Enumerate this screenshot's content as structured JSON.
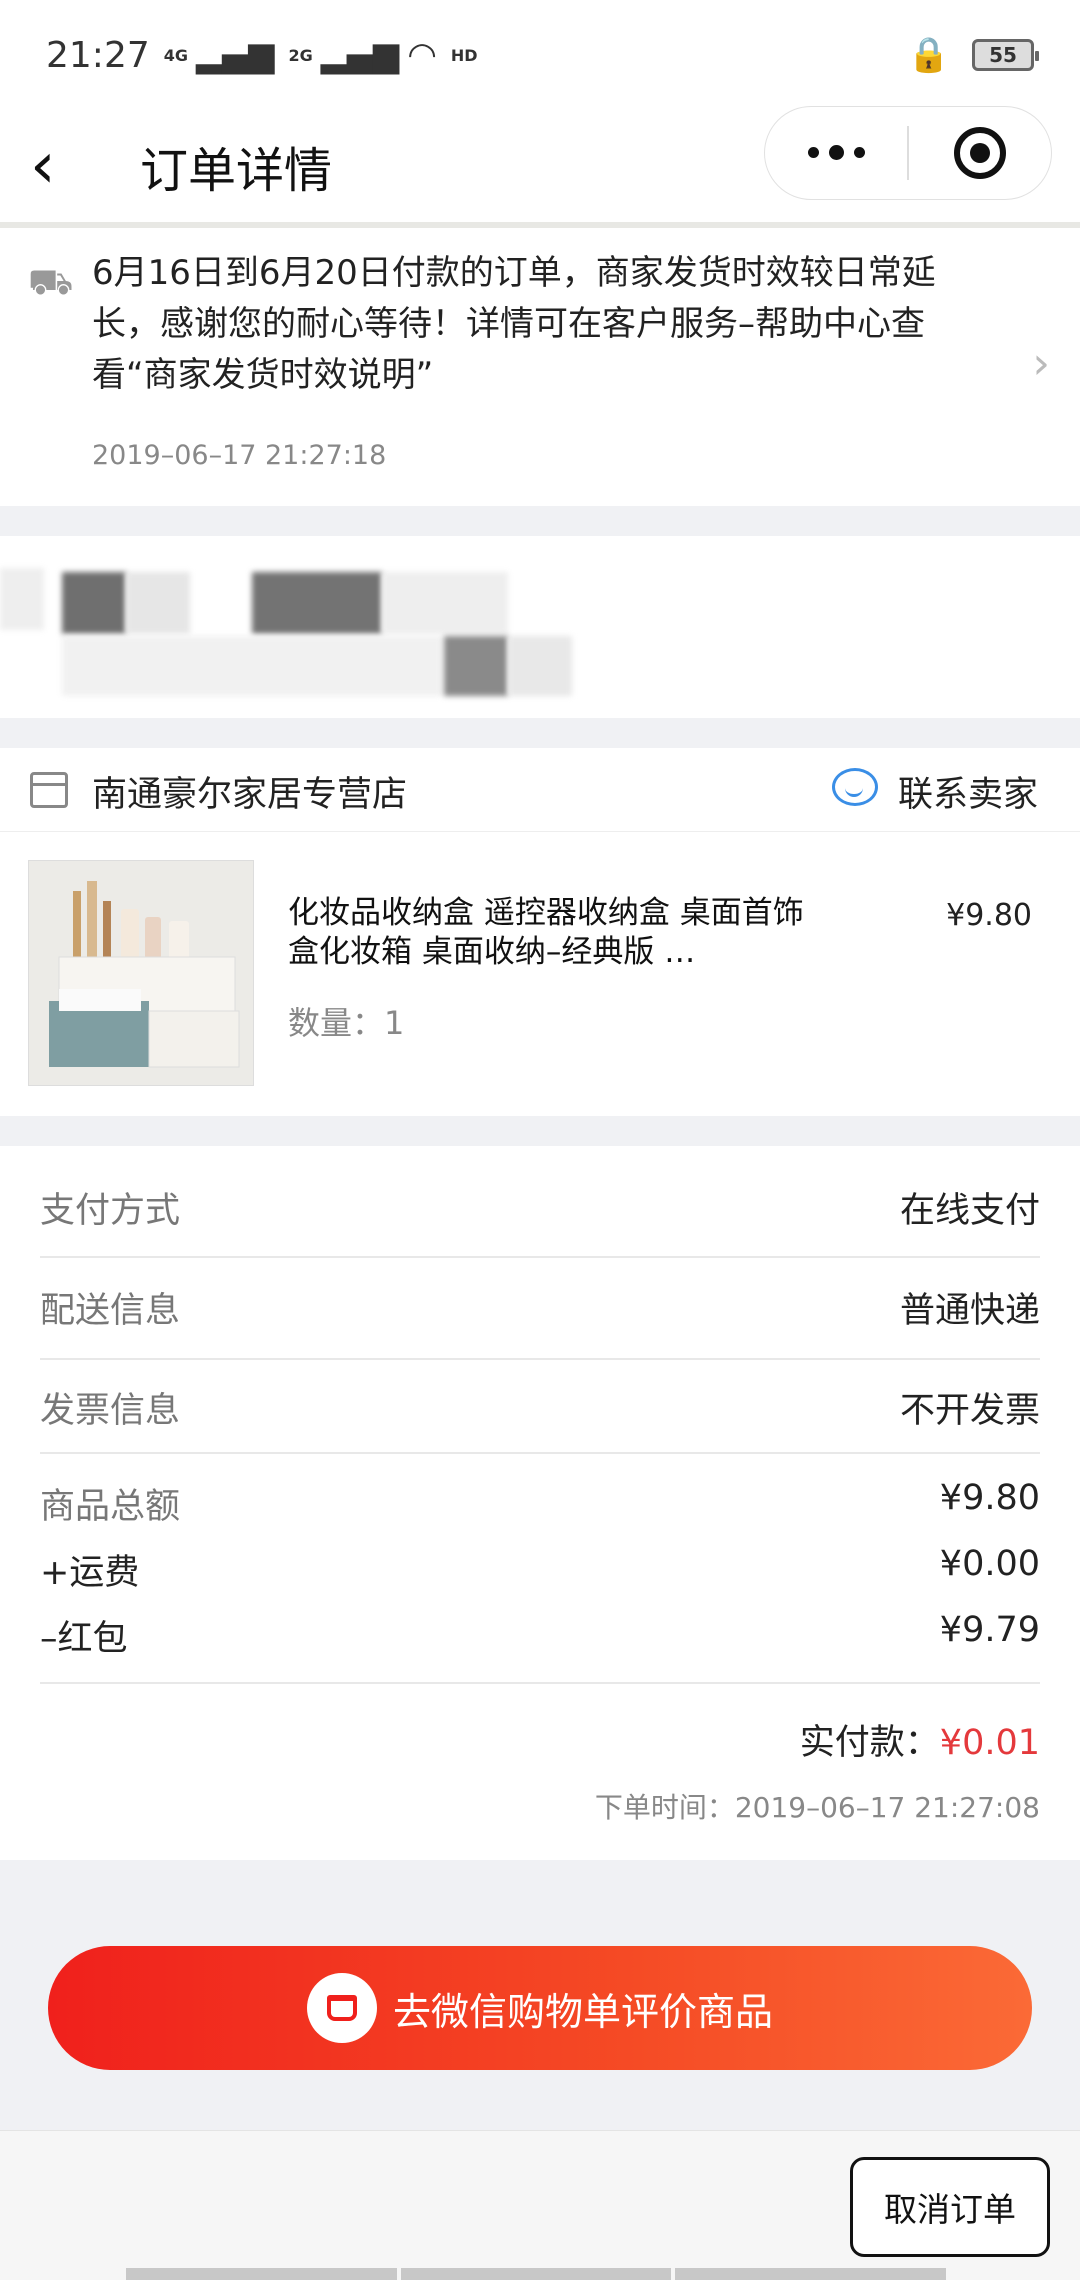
{
  "status_bar": {
    "time": "21:27",
    "signal1": "4G",
    "signal2": "2G",
    "network": "HD",
    "battery": "55"
  },
  "nav": {
    "title": "订单详情"
  },
  "notice": {
    "text": "6月16日到6月20日付款的订单，商家发货时效较日常延长，感谢您的耐心等待！详情可在客户服务–帮助中心查看“商家发货时效说明”",
    "time": "2019–06–17 21:27:18"
  },
  "shop": {
    "name": "南通豪尔家居专营店",
    "contact": "联系卖家"
  },
  "product": {
    "name": "化妆品收纳盒 遥控器收纳盒 桌面首饰盒化妆箱 桌面收纳–经典版 …",
    "price": "¥9.80",
    "quantity": "数量：1"
  },
  "info": {
    "payment": {
      "label": "支付方式",
      "value": "在线支付"
    },
    "delivery": {
      "label": "配送信息",
      "value": "普通快递"
    },
    "invoice": {
      "label": "发票信息",
      "value": "不开发票"
    },
    "subtotal": {
      "label": "商品总额",
      "value": "¥9.80"
    },
    "shipping": {
      "label": "+运费",
      "value": "¥0.00"
    },
    "redpacket": {
      "label": "–红包",
      "value": "¥9.79"
    },
    "paid_label": "实付款：",
    "paid_value": "¥0.01",
    "order_time": "下单时间：2019–06–17 21:27:08"
  },
  "actions": {
    "review": "去微信购物单评价商品",
    "cancel": "取消订单"
  },
  "colors": {
    "accent": "#e4393c",
    "button_start": "#f0201c",
    "button_end": "#fb6a36",
    "link_blue": "#3a8ee6"
  }
}
